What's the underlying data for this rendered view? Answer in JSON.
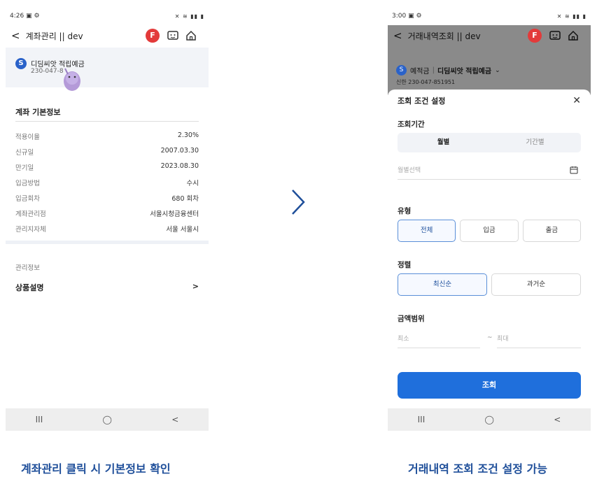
{
  "phone1": {
    "status": {
      "time": "4:26",
      "icons_left": "▣ ⚙",
      "icons_right": "✕ ≋ ▮▮ ▮"
    },
    "appbar": {
      "back": "<",
      "title": "계좌관리 || dev",
      "f_badge": "F"
    },
    "account": {
      "logo": "S",
      "name": "디딤씨앗 적립예금",
      "number": "230-047-8"
    },
    "basic_info": {
      "title": "계좌 기본정보",
      "rows": [
        {
          "key": "적용이율",
          "value": "2.30%"
        },
        {
          "key": "신규일",
          "value": "2007.03.30"
        },
        {
          "key": "만기일",
          "value": "2023.08.30"
        },
        {
          "key": "입금방법",
          "value": "수시"
        },
        {
          "key": "입금회차",
          "value": "680 회차"
        },
        {
          "key": "계좌관리점",
          "value": "서울시청금융센터"
        },
        {
          "key": "관리지자체",
          "value": "서울 서울시"
        }
      ]
    },
    "manage_label": "관리정보",
    "product_menu": {
      "label": "상품설명",
      "chevron": ">"
    },
    "navbar": {
      "recent": "III",
      "home": "◯",
      "back": "<"
    }
  },
  "phone2": {
    "status": {
      "time": "3:00",
      "icons_left": "▣ ⚙",
      "icons_right": "✕ ≋ ▮▮ ▮"
    },
    "appbar": {
      "back": "<",
      "title": "거래내역조회 || dev",
      "f_badge": "F"
    },
    "account": {
      "logo": "S",
      "type": "예적금",
      "sep": "|",
      "name": "디딤씨앗 적립예금",
      "chevron": "⌄",
      "number": "신한 230-047-851951"
    },
    "sheet": {
      "title": "조회 조건 설정",
      "close": "✕",
      "period_label": "조회기간",
      "period_tabs": [
        "월별",
        "기간별"
      ],
      "month_placeholder": "월별선택",
      "type_label": "유형",
      "type_options": [
        "전체",
        "입금",
        "출금"
      ],
      "sort_label": "정렬",
      "sort_options": [
        "최신순",
        "과거순"
      ],
      "amount_label": "금액범위",
      "min_placeholder": "최소",
      "tilde": "~",
      "max_placeholder": "최대",
      "submit": "조회"
    },
    "navbar": {
      "recent": "III",
      "home": "◯",
      "back": "<"
    }
  },
  "captions": {
    "left": "계좌관리 클릭 시 기본정보 확인",
    "right": "거래내역 조회 조건 설정 가능"
  },
  "colors": {
    "accent": "#1f6fdc",
    "caption": "#1f4f9a",
    "f_badge": "#e33a3a",
    "bank_logo": "#2a62c9"
  }
}
